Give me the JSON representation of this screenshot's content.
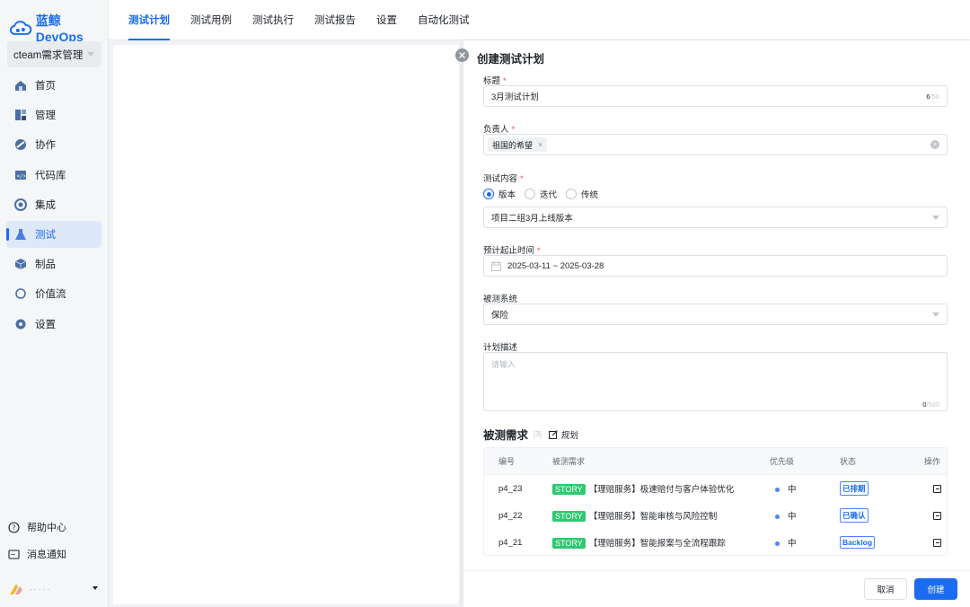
{
  "app": {
    "logo_text": "蓝鲸DevOps",
    "project": "cteam需求管理"
  },
  "sidebar": {
    "items": [
      {
        "label": "首页",
        "icon": "home-icon"
      },
      {
        "label": "管理",
        "icon": "manage-icon"
      },
      {
        "label": "协作",
        "icon": "collaborate-icon"
      },
      {
        "label": "代码库",
        "icon": "code-repo-icon"
      },
      {
        "label": "集成",
        "icon": "integration-icon"
      },
      {
        "label": "测试",
        "icon": "flask-icon",
        "active": true
      },
      {
        "label": "制品",
        "icon": "artifact-icon"
      },
      {
        "label": "价值流",
        "icon": "value-stream-icon"
      },
      {
        "label": "设置",
        "icon": "gear-icon"
      }
    ],
    "help": "帮助中心",
    "notify": "消息通知",
    "user": "· · ·  · ·"
  },
  "topnav": {
    "tabs": [
      "测试计划",
      "测试用例",
      "测试执行",
      "测试报告",
      "设置",
      "自动化测试"
    ],
    "active_index": 0
  },
  "drawer": {
    "title": "创建测试计划",
    "title_label": "标题",
    "title_value": "3月测试计划",
    "title_count": "6",
    "title_max": "/50",
    "owner_label": "负责人",
    "owner_tag": "祖国的希望",
    "content_label": "测试内容",
    "radios": [
      "版本",
      "迭代",
      "传统"
    ],
    "radio_selected": 0,
    "version_value": "项目二组3月上线版本",
    "time_label": "预计起止时间",
    "time_value": "2025-03-11 ~ 2025-03-28",
    "system_label": "被测系统",
    "system_value": "保险",
    "desc_label": "计划描述",
    "desc_placeholder": "请输入",
    "desc_count": "0",
    "desc_max": "/500",
    "req_title": "被测需求",
    "req_count": "[3]",
    "plan_label": "规划",
    "columns": [
      "编号",
      "被测需求",
      "优先级",
      "状态",
      "操作"
    ],
    "rows": [
      {
        "id": "p4_23",
        "type": "STORY",
        "title": "【理赔服务】极速赔付与客户体验优化",
        "priority": "中",
        "status": "已排期"
      },
      {
        "id": "p4_22",
        "type": "STORY",
        "title": "【理赔服务】智能审核与风险控制",
        "priority": "中",
        "status": "已确认"
      },
      {
        "id": "p4_21",
        "type": "STORY",
        "title": "【理赔服务】智能报案与全流程跟踪",
        "priority": "中",
        "status": "Backlog"
      }
    ],
    "cancel": "取消",
    "create": "创建"
  }
}
